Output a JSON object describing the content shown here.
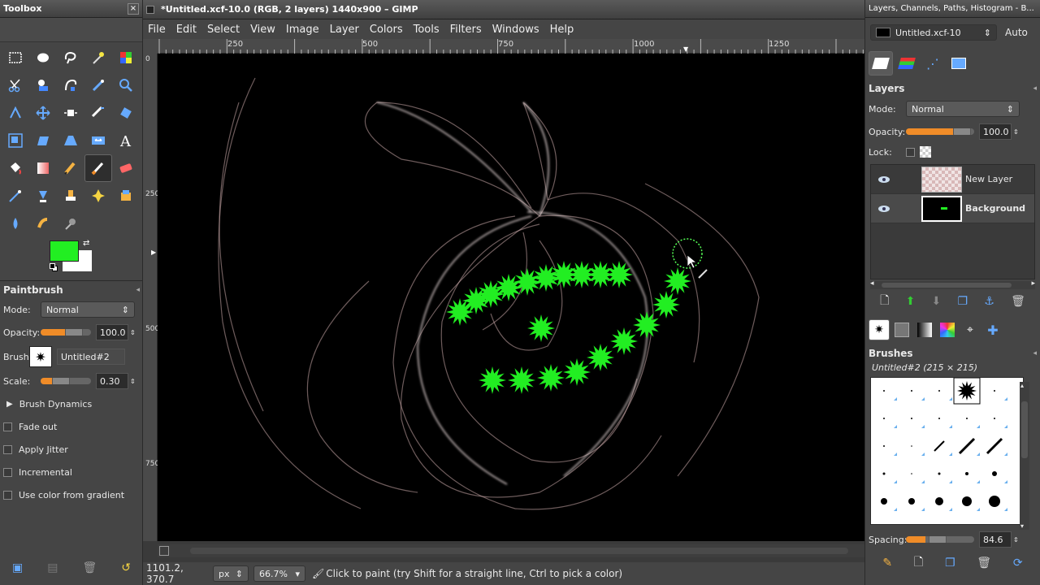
{
  "toolbox": {
    "title": "Toolbox",
    "close": "×"
  },
  "tool_options": {
    "title": "Paintbrush",
    "mode_label": "Mode:",
    "mode_value": "Normal",
    "opacity_label": "Opacity:",
    "opacity_value": "100.0",
    "opacity_fraction": 1.0,
    "brush_label": "Brush:",
    "brush_name": "Untitled#2",
    "scale_label": "Scale:",
    "scale_value": "0.30",
    "scale_fraction": 0.3,
    "dynamics_label": "Brush Dynamics",
    "fade_label": "Fade out",
    "jitter_label": "Apply Jitter",
    "incremental_label": "Incremental",
    "gradient_label": "Use color from gradient"
  },
  "colors": {
    "foreground": "#22ee22",
    "background": "#ffffff"
  },
  "image_window": {
    "title": "*Untitled.xcf-10.0 (RGB, 2 layers) 1440x900 – GIMP",
    "menus": [
      "File",
      "Edit",
      "Select",
      "View",
      "Image",
      "Layer",
      "Colors",
      "Tools",
      "Filters",
      "Windows",
      "Help"
    ],
    "hruler_ticks": [
      "250",
      "500",
      "750",
      "1000",
      "1250"
    ],
    "vruler_ticks": [
      "0",
      "250",
      "500",
      "750"
    ],
    "status": {
      "coords": "1101.2, 370.7",
      "unit": "px",
      "zoom": "66.7%",
      "message": "Click to paint (try Shift for a straight line, Ctrl to pick a color)"
    }
  },
  "dock": {
    "title": "Layers, Channels, Paths, Histogram - B...",
    "image_select": "Untitled.xcf-10",
    "auto_label": "Auto",
    "layers": {
      "title": "Layers",
      "mode_label": "Mode:",
      "mode_value": "Normal",
      "opacity_label": "Opacity:",
      "opacity_value": "100.0",
      "opacity_fraction": 1.0,
      "lock_label": "Lock:",
      "items": [
        {
          "name": "New Layer",
          "bold": false
        },
        {
          "name": "Background",
          "bold": true
        }
      ]
    },
    "brushes": {
      "title": "Brushes",
      "current": "Untitled#2 (215 × 215)",
      "spacing_label": "Spacing:",
      "spacing_value": "84.6",
      "spacing_fraction": 0.18
    }
  }
}
